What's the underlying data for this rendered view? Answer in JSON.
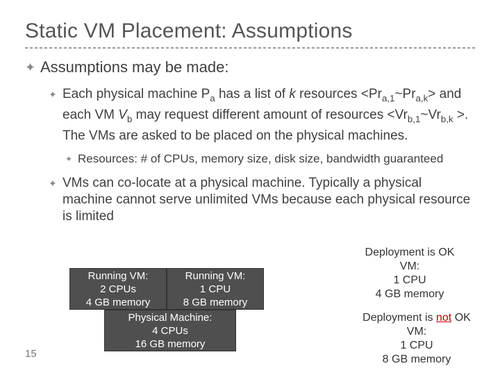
{
  "title": "Static VM Placement: Assumptions",
  "bullets": {
    "l1": "Assumptions may be made:",
    "l2a_pre": "Each physical machine P",
    "l2a_sub1": "a",
    "l2a_mid1": " has a list of ",
    "l2a_k": "k",
    "l2a_mid2": " resources <Pr",
    "l2a_sub2": "a,1",
    "l2a_mid3": "~Pr",
    "l2a_sub3": "a,k",
    "l2a_mid4": "> and each VM ",
    "l2a_v": "V",
    "l2a_sub4": "b",
    "l2a_mid5": " may request  different amount of resources <Vr",
    "l2a_sub5": "b,1",
    "l2a_mid6": "~Vr",
    "l2a_sub6": "b,k",
    "l2a_end": " >.  The VMs are asked to be placed on the physical machines.",
    "l3": "Resources:  # of CPUs, memory size, disk size, bandwidth guaranteed",
    "l2b": "VMs can co-locate at a physical machine. Typically a physical machine cannot serve unlimited VMs because each physical resource is limited"
  },
  "boxes": {
    "vm1": {
      "l1": "Running VM:",
      "l2": "2 CPUs",
      "l3": "4 GB memory"
    },
    "vm2": {
      "l1": "Running VM:",
      "l2": "1 CPU",
      "l3": "8 GB memory"
    },
    "pm": {
      "l1": "Physical Machine:",
      "l2": "4 CPUs",
      "l3": "16 GB memory"
    }
  },
  "deploy": {
    "ok": {
      "line1": "Deployment is OK",
      "line2": "VM:",
      "line3": "1 CPU",
      "line4": "4 GB memory"
    },
    "notok_pre": "Deployment is ",
    "notok_not": "not",
    "notok_post": " OK",
    "notok": {
      "line2": "VM:",
      "line3": "1 CPU",
      "line4": "8 GB memory"
    }
  },
  "page": "15",
  "glyph": {
    "bullet": "✦"
  }
}
